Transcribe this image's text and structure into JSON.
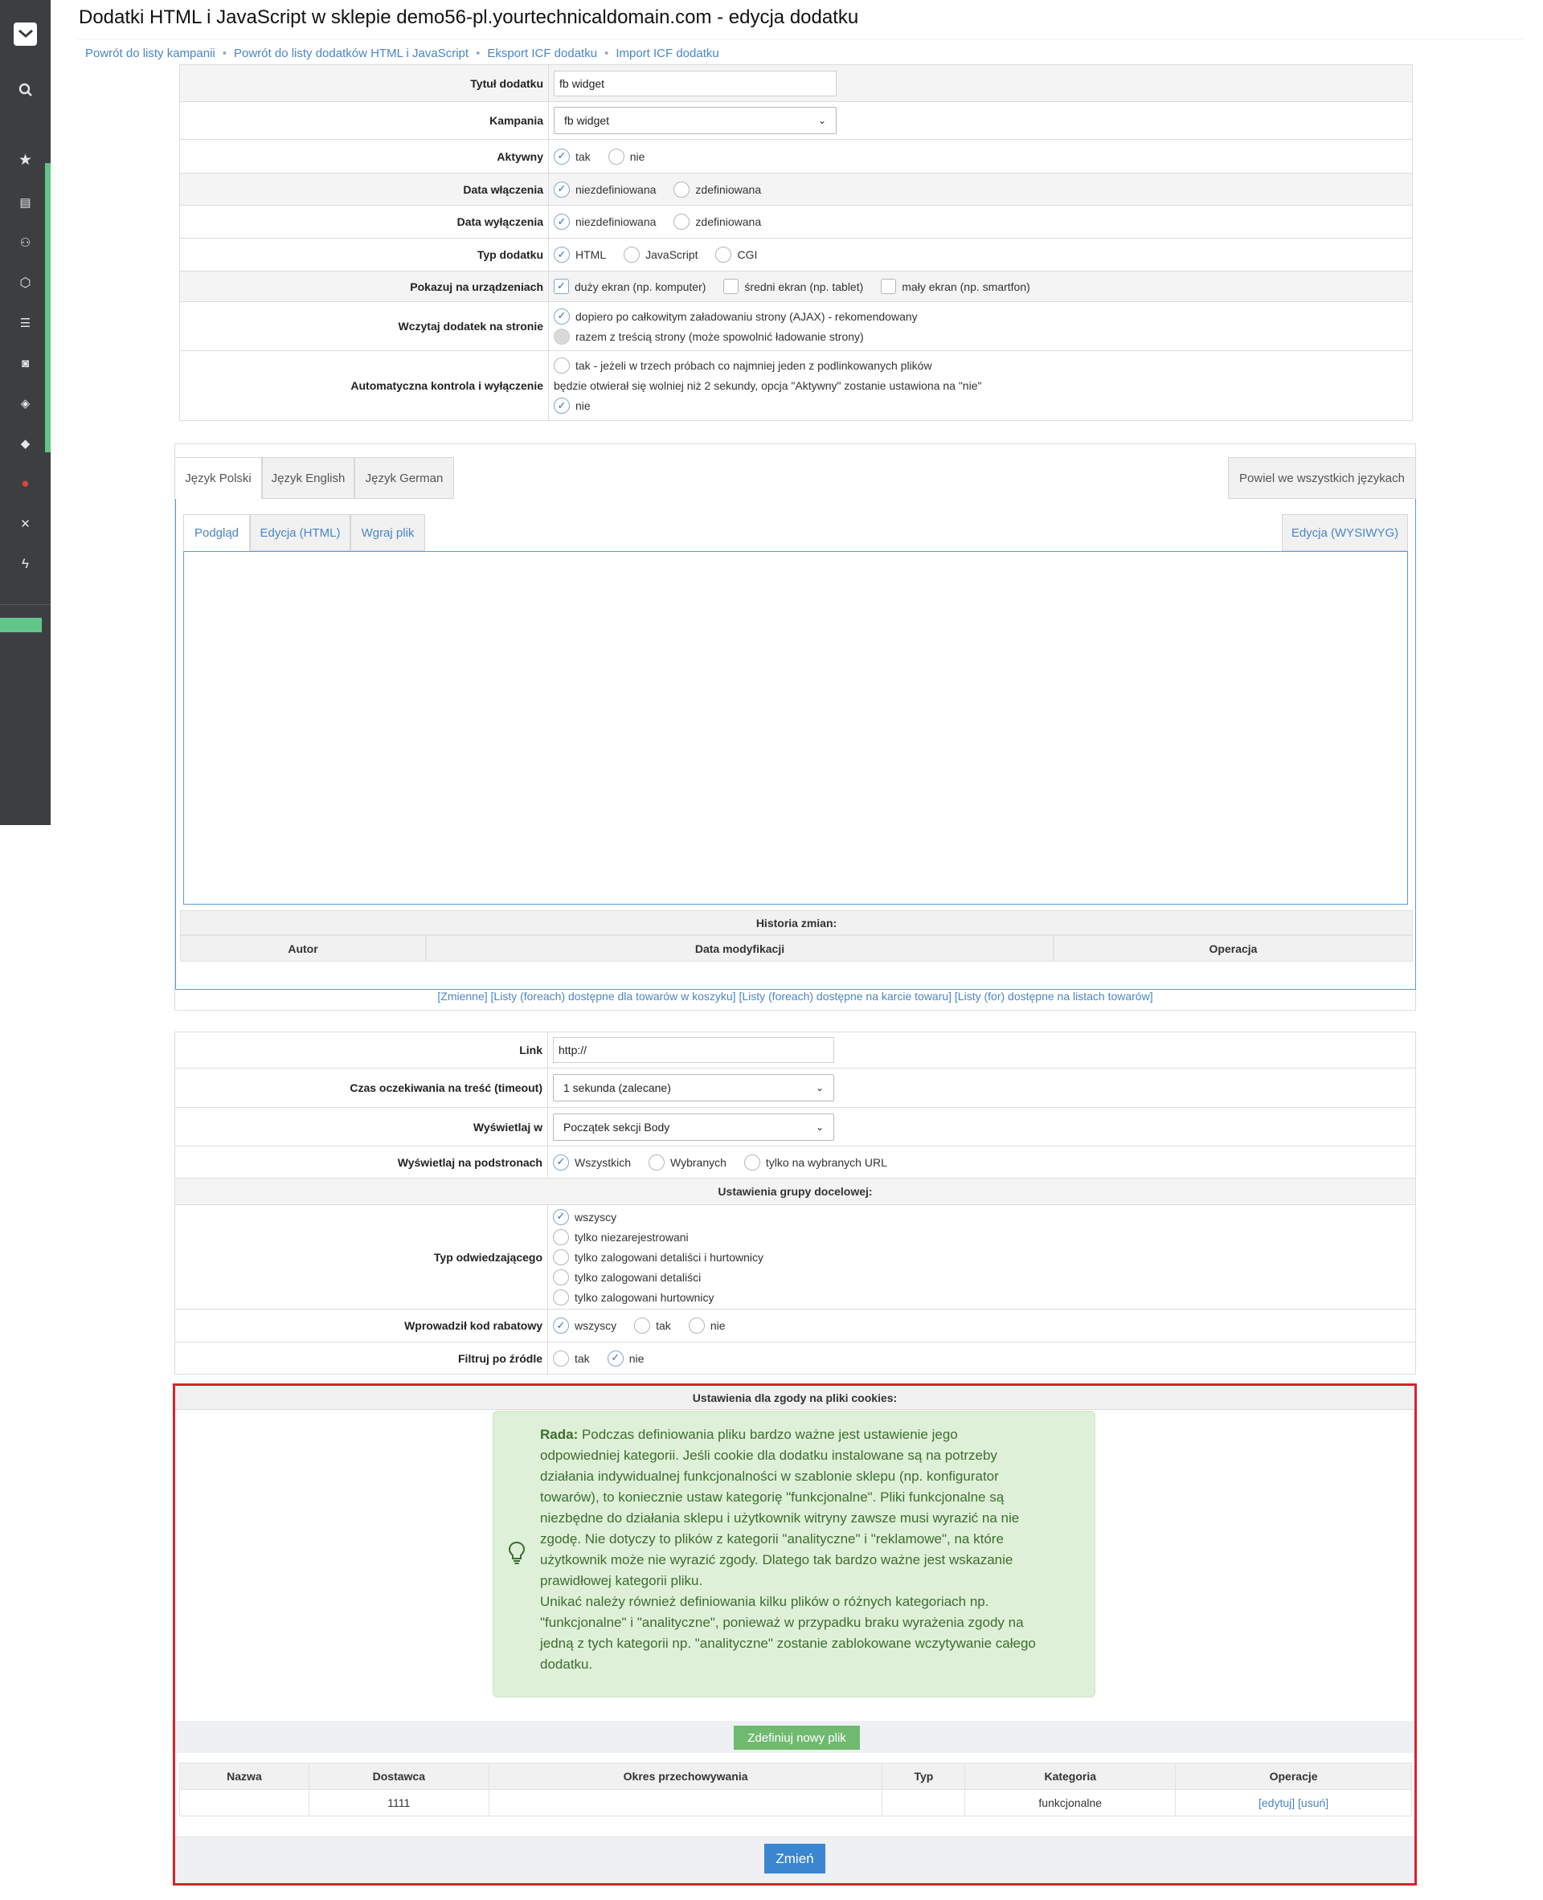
{
  "page_title": "Dodatki HTML i JavaScript w sklepie demo56-pl.yourtechnicaldomain.com - edycja dodatku",
  "breadcrumbs": [
    "Powrót do listy kampanii",
    "Powrót do listy dodatków HTML i JavaScript",
    "Eksport ICF dodatku",
    "Import ICF dodatku"
  ],
  "sidebar": {
    "icons": [
      "logo-icon",
      "search-icon",
      "star-icon",
      "orders-icon",
      "users-icon",
      "box-icon",
      "list-icon",
      "camera-icon",
      "layers-icon",
      "tag-icon",
      "globe-icon",
      "shuffle-icon",
      "bolt-icon"
    ],
    "accent_color": "#62c58a"
  },
  "form1": {
    "title_label": "Tytuł dodatku",
    "title_value": "fb widget",
    "campaign_label": "Kampania",
    "campaign_value": "fb widget",
    "active_label": "Aktywny",
    "active_yes": "tak",
    "active_no": "nie",
    "start_label": "Data włączenia",
    "end_label": "Data wyłączenia",
    "undefined": "niezdefiniowana",
    "defined": "zdefiniowana",
    "type_label": "Typ dodatku",
    "type_html": "HTML",
    "type_js": "JavaScript",
    "type_cgi": "CGI",
    "devices_label": "Pokazuj na urządzeniach",
    "device_large": "duży ekran (np. komputer)",
    "device_medium": "średni ekran (np. tablet)",
    "device_small": "mały ekran (np. smartfon)",
    "load_label": "Wczytaj dodatek na stronie",
    "load_ajax": "dopiero po całkowitym załadowaniu strony (AJAX) - rekomendowany",
    "load_inline": "razem z treścią strony (może spowolnić ładowanie strony)",
    "autocheck_label": "Automatyczna kontrola i wyłączenie",
    "autocheck_yes_1": "tak - jeżeli w trzech próbach co najmniej jeden z podlinkowanych plików",
    "autocheck_yes_2": "będzie otwierał się wolniej niż 2 sekundy, opcja \"Aktywny\" zostanie ustawiona na \"nie\"",
    "autocheck_no": "nie"
  },
  "lang_tabs": {
    "polish": "Język Polski",
    "english": "Język English",
    "german": "Język German",
    "repeat_all": "Powiel we wszystkich językach"
  },
  "editor_tabs": {
    "preview": "Podgląd",
    "edit_html": "Edycja (HTML)",
    "upload": "Wgraj plik",
    "wysiwyg": "Edycja (WYSIWYG)"
  },
  "history": {
    "title": "Historia zmian:",
    "col_author": "Autor",
    "col_date": "Data modyfikacji",
    "col_operation": "Operacja"
  },
  "vars_links": [
    "[Zmienne]",
    "[Listy (foreach) dostępne dla towarów w koszyku]",
    "[Listy (foreach) dostępne na karcie towaru]",
    "[Listy (for) dostępne na listach towarów]"
  ],
  "form2": {
    "link_label": "Link",
    "link_value": "http://",
    "timeout_label": "Czas oczekiwania na treść (timeout)",
    "timeout_value": "1 sekunda (zalecane)",
    "display_in_label": "Wyświetlaj w",
    "display_in_value": "Początek sekcji Body",
    "subpages_label": "Wyświetlaj na podstronach",
    "subpages_all": "Wszystkich",
    "subpages_selected": "Wybranych",
    "subpages_url": "tylko na wybranych URL",
    "target_group_head": "Ustawienia grupy docelowej:",
    "visitor_label": "Typ odwiedzającego",
    "visitor_opts": [
      "wszyscy",
      "tylko niezarejestrowani",
      "tylko zalogowani detaliści i hurtownicy",
      "tylko zalogowani detaliści",
      "tylko zalogowani hurtownicy"
    ],
    "discount_label": "Wprowadził kod rabatowy",
    "discount_all": "wszyscy",
    "discount_yes": "tak",
    "discount_no": "nie",
    "source_label": "Filtruj po źródle",
    "source_yes": "tak",
    "source_no": "nie"
  },
  "cookies": {
    "head": "Ustawienia dla zgody na pliki cookies:",
    "tip_title": "Rada:",
    "tip_lines": [
      "Podczas definiowania pliku bardzo ważne jest ustawienie jego",
      "odpowiedniej kategorii. Jeśli cookie dla dodatku instalowane są na potrzeby",
      "działania indywidualnej funkcjonalności w szablonie sklepu (np. konfigurator",
      "towarów), to koniecznie ustaw kategorię \"funkcjonalne\". Pliki funkcjonalne są",
      "niezbędne do działania sklepu i użytkownik witryny zawsze musi wyrazić na nie",
      "zgodę. Nie dotyczy to plików z kategorii \"analityczne\" i \"reklamowe\", na które",
      "użytkownik może nie wyrazić zgody. Dlatego tak bardzo ważne jest wskazanie",
      "prawidłowej kategorii pliku.",
      "Unikać należy również definiowania kilku plików o różnych kategoriach np.",
      "\"funkcjonalne\" i \"analityczne\", ponieważ w przypadku braku wyrażenia zgody na",
      "jedną z tych kategorii np. \"analityczne\" zostanie zablokowane wczytywanie całego",
      "dodatku."
    ],
    "define_button": "Zdefiniuj nowy plik",
    "columns": [
      "Nazwa",
      "Dostawca",
      "Okres przechowywania",
      "Typ",
      "Kategoria",
      "Operacje"
    ],
    "row": {
      "name": "",
      "provider": "1111",
      "period": "",
      "type": "",
      "category": "funkcjonalne",
      "edit": "[edytuj]",
      "delete": "[usuń]"
    },
    "save_button": "Zmień"
  }
}
